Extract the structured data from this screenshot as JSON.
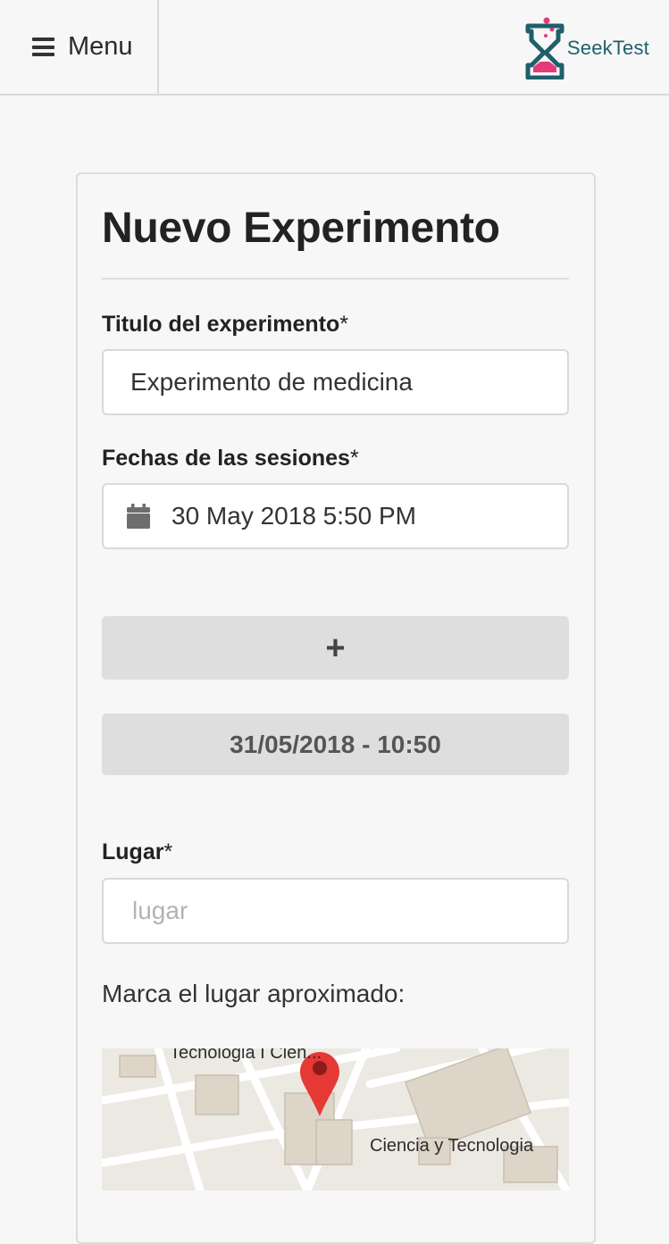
{
  "header": {
    "menu_label": "Menu",
    "logo_text": "SeekTest"
  },
  "form": {
    "title": "Nuevo Experimento",
    "experiment_title": {
      "label": "Titulo del experimento",
      "required_mark": "*",
      "value": "Experimento de medicina"
    },
    "session_dates": {
      "label": "Fechas de las sesiones",
      "required_mark": "*",
      "value": "30 May 2018 5:50 PM"
    },
    "add_button": "+",
    "session_entry": "31/05/2018 - 10:50",
    "place": {
      "label": "Lugar",
      "required_mark": "*",
      "placeholder": "lugar"
    },
    "map_prompt": "Marca el lugar aproximado:",
    "map": {
      "labels": [
        "Tecnologia I Cien...",
        "Ciencia y Tecnologia"
      ],
      "pin_color": "#e53935"
    }
  },
  "colors": {
    "logo_teal": "#1f5f6b",
    "logo_pink": "#e5397a"
  }
}
